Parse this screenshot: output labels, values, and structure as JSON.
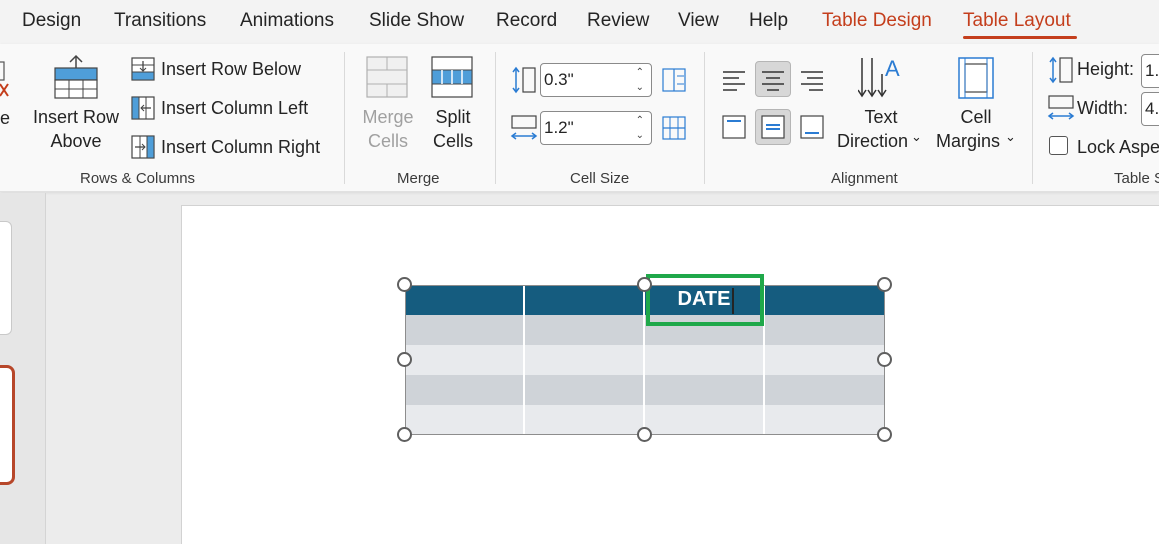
{
  "tabs": [
    {
      "label": "Design"
    },
    {
      "label": "Transitions"
    },
    {
      "label": "Animations"
    },
    {
      "label": "Slide Show"
    },
    {
      "label": "Record"
    },
    {
      "label": "Review"
    },
    {
      "label": "View"
    },
    {
      "label": "Help"
    },
    {
      "label": "Table Design"
    },
    {
      "label": "Table Layout"
    }
  ],
  "ribbon": {
    "rows_columns": {
      "partial_label": "e",
      "insert_row_above": [
        "Insert Row",
        "Above"
      ],
      "insert_row_below": "Insert Row Below",
      "insert_column_left": "Insert Column Left",
      "insert_column_right": "Insert Column Right",
      "group_label": "Rows & Columns"
    },
    "merge": {
      "merge_cells": [
        "Merge",
        "Cells"
      ],
      "split_cells": [
        "Split",
        "Cells"
      ],
      "group_label": "Merge"
    },
    "cell_size": {
      "height_value": "0.3\"",
      "width_value": "1.2\"",
      "group_label": "Cell Size"
    },
    "alignment": {
      "text_direction": [
        "Text",
        "Direction"
      ],
      "cell_margins": [
        "Cell",
        "Margins"
      ],
      "group_label": "Alignment"
    },
    "table_size": {
      "height_label": "Height:",
      "height_value": "1.",
      "width_label": "Width:",
      "width_value": "4.",
      "lock_aspect": "Lock Aspe",
      "group_label": "Table S"
    }
  },
  "table": {
    "header_text": "DATE",
    "header_color": "#155c7f",
    "band_dark": "#cfd3d8",
    "band_light": "#e8eaed",
    "highlight_color": "#1fa84a"
  },
  "accent_color": "#c43e1c"
}
